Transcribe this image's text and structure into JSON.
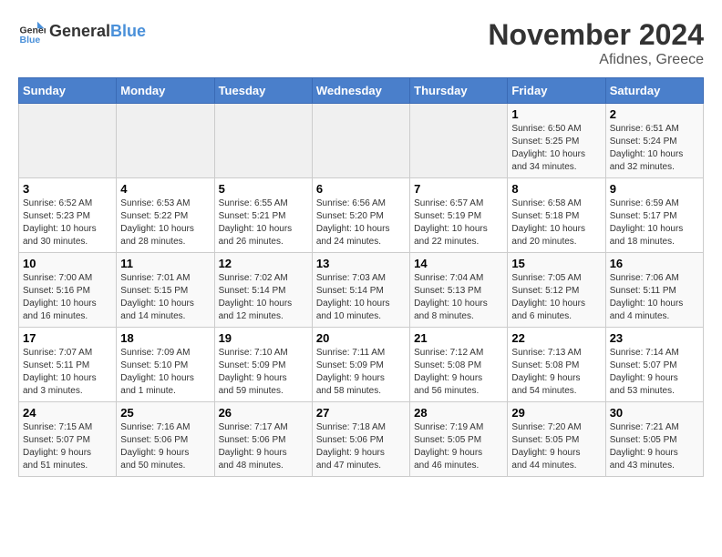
{
  "header": {
    "logo_line1": "General",
    "logo_line2": "Blue",
    "month": "November 2024",
    "location": "Afidnes, Greece"
  },
  "weekdays": [
    "Sunday",
    "Monday",
    "Tuesday",
    "Wednesday",
    "Thursday",
    "Friday",
    "Saturday"
  ],
  "rows": [
    [
      {
        "day": "",
        "info": ""
      },
      {
        "day": "",
        "info": ""
      },
      {
        "day": "",
        "info": ""
      },
      {
        "day": "",
        "info": ""
      },
      {
        "day": "",
        "info": ""
      },
      {
        "day": "1",
        "info": "Sunrise: 6:50 AM\nSunset: 5:25 PM\nDaylight: 10 hours\nand 34 minutes."
      },
      {
        "day": "2",
        "info": "Sunrise: 6:51 AM\nSunset: 5:24 PM\nDaylight: 10 hours\nand 32 minutes."
      }
    ],
    [
      {
        "day": "3",
        "info": "Sunrise: 6:52 AM\nSunset: 5:23 PM\nDaylight: 10 hours\nand 30 minutes."
      },
      {
        "day": "4",
        "info": "Sunrise: 6:53 AM\nSunset: 5:22 PM\nDaylight: 10 hours\nand 28 minutes."
      },
      {
        "day": "5",
        "info": "Sunrise: 6:55 AM\nSunset: 5:21 PM\nDaylight: 10 hours\nand 26 minutes."
      },
      {
        "day": "6",
        "info": "Sunrise: 6:56 AM\nSunset: 5:20 PM\nDaylight: 10 hours\nand 24 minutes."
      },
      {
        "day": "7",
        "info": "Sunrise: 6:57 AM\nSunset: 5:19 PM\nDaylight: 10 hours\nand 22 minutes."
      },
      {
        "day": "8",
        "info": "Sunrise: 6:58 AM\nSunset: 5:18 PM\nDaylight: 10 hours\nand 20 minutes."
      },
      {
        "day": "9",
        "info": "Sunrise: 6:59 AM\nSunset: 5:17 PM\nDaylight: 10 hours\nand 18 minutes."
      }
    ],
    [
      {
        "day": "10",
        "info": "Sunrise: 7:00 AM\nSunset: 5:16 PM\nDaylight: 10 hours\nand 16 minutes."
      },
      {
        "day": "11",
        "info": "Sunrise: 7:01 AM\nSunset: 5:15 PM\nDaylight: 10 hours\nand 14 minutes."
      },
      {
        "day": "12",
        "info": "Sunrise: 7:02 AM\nSunset: 5:14 PM\nDaylight: 10 hours\nand 12 minutes."
      },
      {
        "day": "13",
        "info": "Sunrise: 7:03 AM\nSunset: 5:14 PM\nDaylight: 10 hours\nand 10 minutes."
      },
      {
        "day": "14",
        "info": "Sunrise: 7:04 AM\nSunset: 5:13 PM\nDaylight: 10 hours\nand 8 minutes."
      },
      {
        "day": "15",
        "info": "Sunrise: 7:05 AM\nSunset: 5:12 PM\nDaylight: 10 hours\nand 6 minutes."
      },
      {
        "day": "16",
        "info": "Sunrise: 7:06 AM\nSunset: 5:11 PM\nDaylight: 10 hours\nand 4 minutes."
      }
    ],
    [
      {
        "day": "17",
        "info": "Sunrise: 7:07 AM\nSunset: 5:11 PM\nDaylight: 10 hours\nand 3 minutes."
      },
      {
        "day": "18",
        "info": "Sunrise: 7:09 AM\nSunset: 5:10 PM\nDaylight: 10 hours\nand 1 minute."
      },
      {
        "day": "19",
        "info": "Sunrise: 7:10 AM\nSunset: 5:09 PM\nDaylight: 9 hours\nand 59 minutes."
      },
      {
        "day": "20",
        "info": "Sunrise: 7:11 AM\nSunset: 5:09 PM\nDaylight: 9 hours\nand 58 minutes."
      },
      {
        "day": "21",
        "info": "Sunrise: 7:12 AM\nSunset: 5:08 PM\nDaylight: 9 hours\nand 56 minutes."
      },
      {
        "day": "22",
        "info": "Sunrise: 7:13 AM\nSunset: 5:08 PM\nDaylight: 9 hours\nand 54 minutes."
      },
      {
        "day": "23",
        "info": "Sunrise: 7:14 AM\nSunset: 5:07 PM\nDaylight: 9 hours\nand 53 minutes."
      }
    ],
    [
      {
        "day": "24",
        "info": "Sunrise: 7:15 AM\nSunset: 5:07 PM\nDaylight: 9 hours\nand 51 minutes."
      },
      {
        "day": "25",
        "info": "Sunrise: 7:16 AM\nSunset: 5:06 PM\nDaylight: 9 hours\nand 50 minutes."
      },
      {
        "day": "26",
        "info": "Sunrise: 7:17 AM\nSunset: 5:06 PM\nDaylight: 9 hours\nand 48 minutes."
      },
      {
        "day": "27",
        "info": "Sunrise: 7:18 AM\nSunset: 5:06 PM\nDaylight: 9 hours\nand 47 minutes."
      },
      {
        "day": "28",
        "info": "Sunrise: 7:19 AM\nSunset: 5:05 PM\nDaylight: 9 hours\nand 46 minutes."
      },
      {
        "day": "29",
        "info": "Sunrise: 7:20 AM\nSunset: 5:05 PM\nDaylight: 9 hours\nand 44 minutes."
      },
      {
        "day": "30",
        "info": "Sunrise: 7:21 AM\nSunset: 5:05 PM\nDaylight: 9 hours\nand 43 minutes."
      }
    ]
  ]
}
